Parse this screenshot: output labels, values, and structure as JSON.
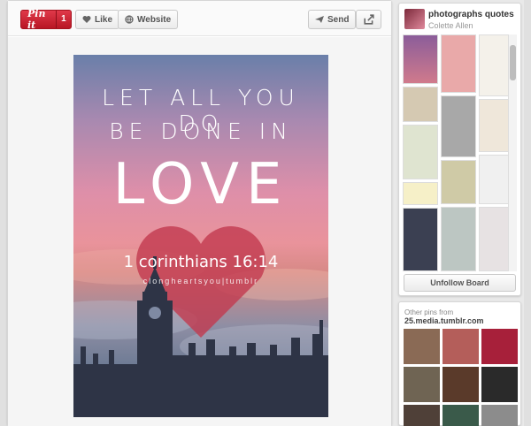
{
  "toolbar": {
    "pinit_label": "Pin it",
    "pinit_count": "1",
    "like_label": "Like",
    "website_label": "Website",
    "send_label": "Send"
  },
  "pin": {
    "line1": "LET ALL YOU DO",
    "line2": "BE DONE IN",
    "line3": "LOVE",
    "verse": "1 corinthians 16:14",
    "credit": "clongheartsyou|tumblr"
  },
  "board": {
    "title": "photographs quotes",
    "owner": "Colette Allen",
    "unfollow_label": "Unfollow Board"
  },
  "other_pins": {
    "label": "Other pins from",
    "source": "25.media.tumblr.com"
  },
  "colors": {
    "pinit_red": "#c8202f",
    "heart": "#c23a4f"
  }
}
